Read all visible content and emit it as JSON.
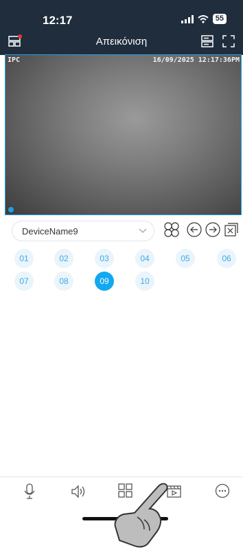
{
  "status_bar": {
    "time": "12:17",
    "battery": "55"
  },
  "header": {
    "title": "Απεικόνιση"
  },
  "video": {
    "label_left": "IPC",
    "timestamp": "16/09/2025 12:17:36PM"
  },
  "device": {
    "selected": "DeviceName9"
  },
  "channels": [
    "01",
    "02",
    "03",
    "04",
    "05",
    "06",
    "07",
    "08",
    "09",
    "10"
  ],
  "selected_channel": "09",
  "colors": {
    "accent": "#12a8f0",
    "header_bg": "#1f2d3d"
  },
  "icons": {
    "header": [
      "multi-screen-icon",
      "device-list-icon",
      "fullscreen-icon"
    ],
    "controls": [
      "channel-grid-icon",
      "previous-icon",
      "next-icon",
      "close-window-icon"
    ],
    "bottom": [
      "microphone-icon",
      "speaker-icon",
      "split-view-icon",
      "playback-icon",
      "more-icon"
    ]
  }
}
